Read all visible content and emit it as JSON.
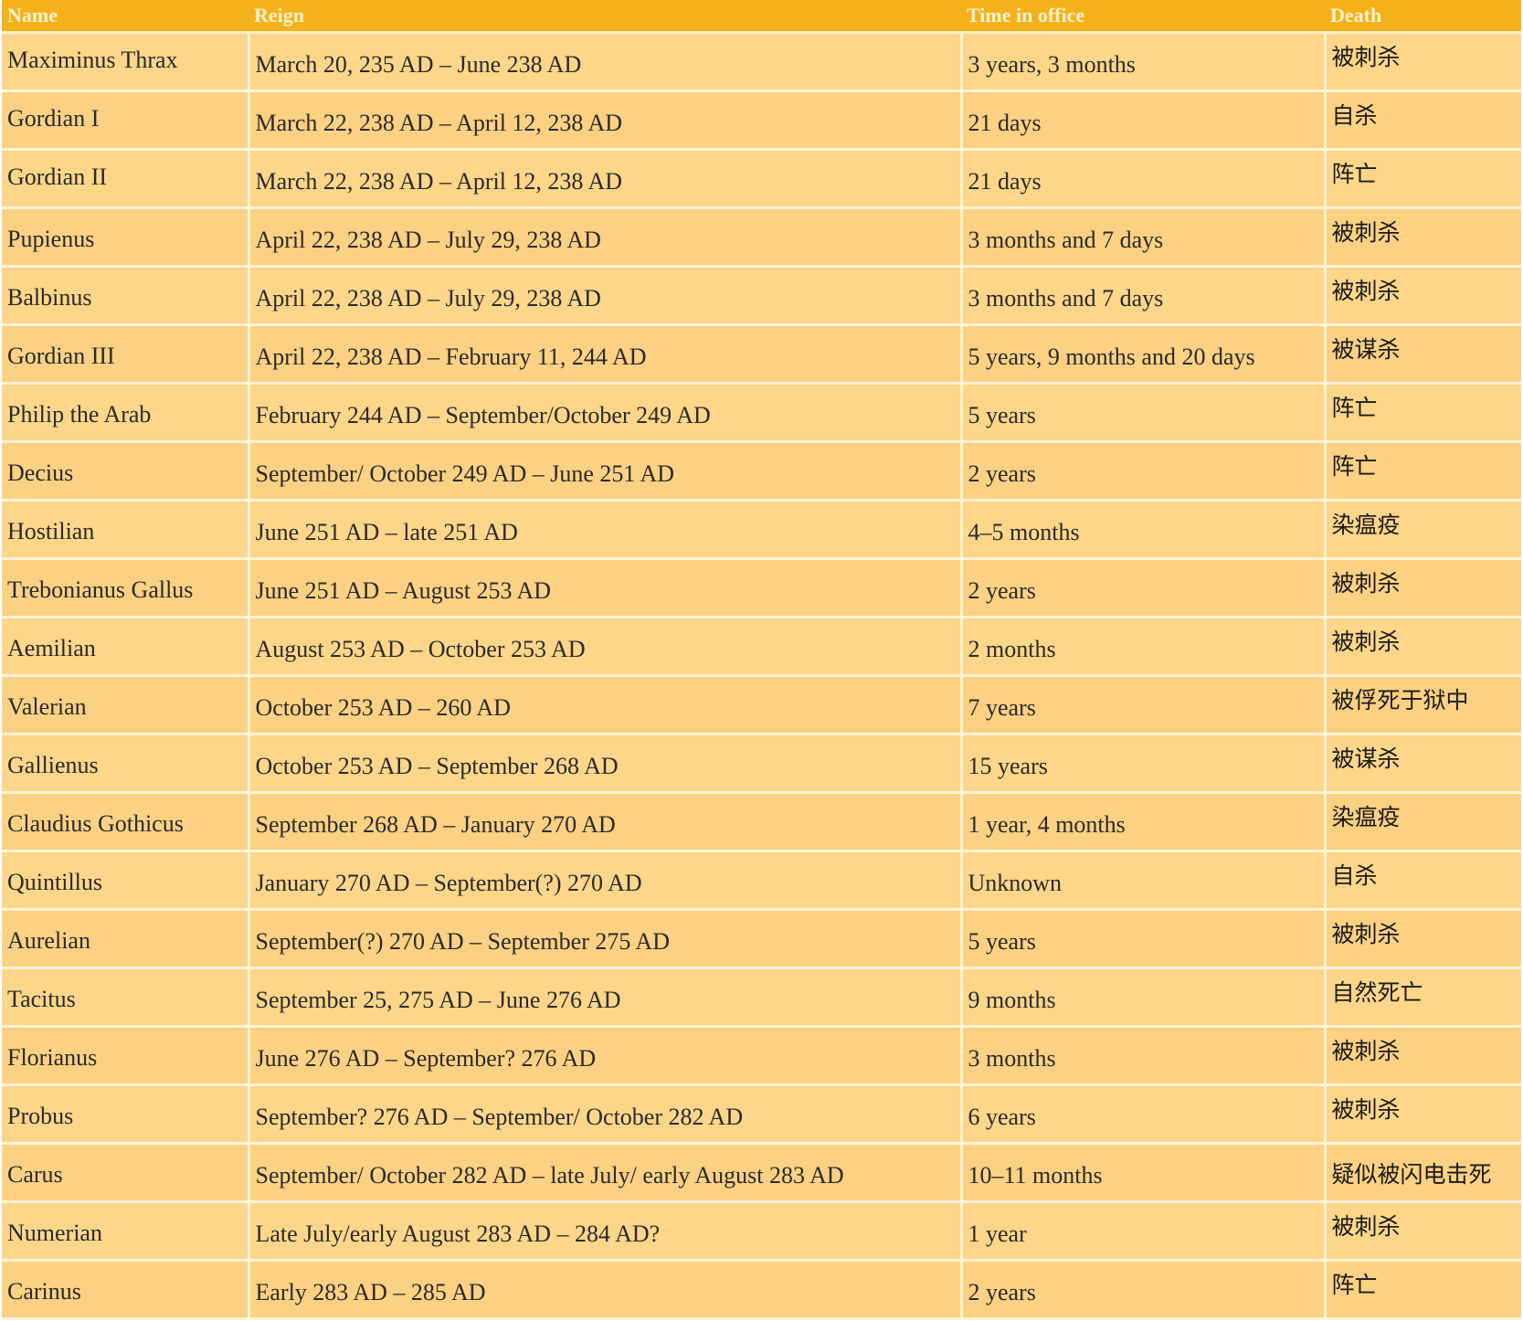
{
  "table": {
    "headers": [
      "Name",
      "Reign",
      "Time in office",
      "Death"
    ],
    "rows": [
      {
        "name": "Maximinus Thrax",
        "reign": "March 20, 235 AD – June 238 AD",
        "time": "3 years, 3 months",
        "death": "被刺杀"
      },
      {
        "name": "Gordian I",
        "reign": "March 22, 238 AD – April 12, 238 AD",
        "time": "21 days",
        "death": "自杀"
      },
      {
        "name": "Gordian II",
        "reign": "March 22, 238 AD – April 12, 238 AD",
        "time": "21 days",
        "death": "阵亡"
      },
      {
        "name": "Pupienus",
        "reign": "April 22, 238 AD – July 29, 238 AD",
        "time": "3 months and 7 days",
        "death": "被刺杀"
      },
      {
        "name": "Balbinus",
        "reign": "April 22, 238 AD – July 29, 238 AD",
        "time": "3 months and 7 days",
        "death": "被刺杀"
      },
      {
        "name": "Gordian III",
        "reign": "April 22, 238 AD – February 11, 244 AD",
        "time": "5 years, 9 months and 20 days",
        "death": "被谋杀"
      },
      {
        "name": "Philip the Arab",
        "reign": "February 244 AD – September/October 249 AD",
        "time": "5 years",
        "death": "阵亡"
      },
      {
        "name": "Decius",
        "reign": "September/ October 249 AD – June 251 AD",
        "time": "2 years",
        "death": "阵亡"
      },
      {
        "name": "Hostilian",
        "reign": "June 251 AD – late 251 AD",
        "time": "4–5 months",
        "death": "染瘟疫"
      },
      {
        "name": "Trebonianus Gallus",
        "reign": "June 251 AD – August 253 AD",
        "time": "2 years",
        "death": "被刺杀"
      },
      {
        "name": "Aemilian",
        "reign": "August 253 AD – October 253 AD",
        "time": "2 months",
        "death": "被刺杀"
      },
      {
        "name": "Valerian",
        "reign": "October 253 AD – 260 AD",
        "time": "7 years",
        "death": "被俘死于狱中"
      },
      {
        "name": "Gallienus",
        "reign": "October 253 AD – September 268 AD",
        "time": "15 years",
        "death": "被谋杀"
      },
      {
        "name": "Claudius Gothicus",
        "reign": "September 268 AD – January 270 AD",
        "time": "1 year, 4 months",
        "death": "染瘟疫"
      },
      {
        "name": "Quintillus",
        "reign": "January 270 AD – September(?) 270 AD",
        "time": "Unknown",
        "death": "自杀"
      },
      {
        "name": "Aurelian",
        "reign": "September(?) 270 AD – September 275 AD",
        "time": "5 years",
        "death": "被刺杀"
      },
      {
        "name": "Tacitus",
        "reign": "September 25, 275 AD – June 276 AD",
        "time": "9 months",
        "death": "自然死亡"
      },
      {
        "name": "Florianus",
        "reign": "June 276 AD – September? 276 AD",
        "time": "3 months",
        "death": "被刺杀"
      },
      {
        "name": "Probus",
        "reign": "September? 276 AD – September/ October 282 AD",
        "time": "6 years",
        "death": "被刺杀"
      },
      {
        "name": "Carus",
        "reign": "September/ October 282 AD – late July/ early August 283 AD",
        "time": "10–11 months",
        "death": "疑似被闪电击死"
      },
      {
        "name": "Numerian",
        "reign": "Late July/early August 283 AD – 284 AD?",
        "time": "1 year",
        "death": "被刺杀"
      },
      {
        "name": "Carinus",
        "reign": "Early 283 AD – 285 AD",
        "time": "2 years",
        "death": "阵亡"
      }
    ]
  },
  "colors": {
    "header_bg": "#f5b11b",
    "row_bg": "#fdd68a",
    "grid_line": "#fff3d6"
  }
}
